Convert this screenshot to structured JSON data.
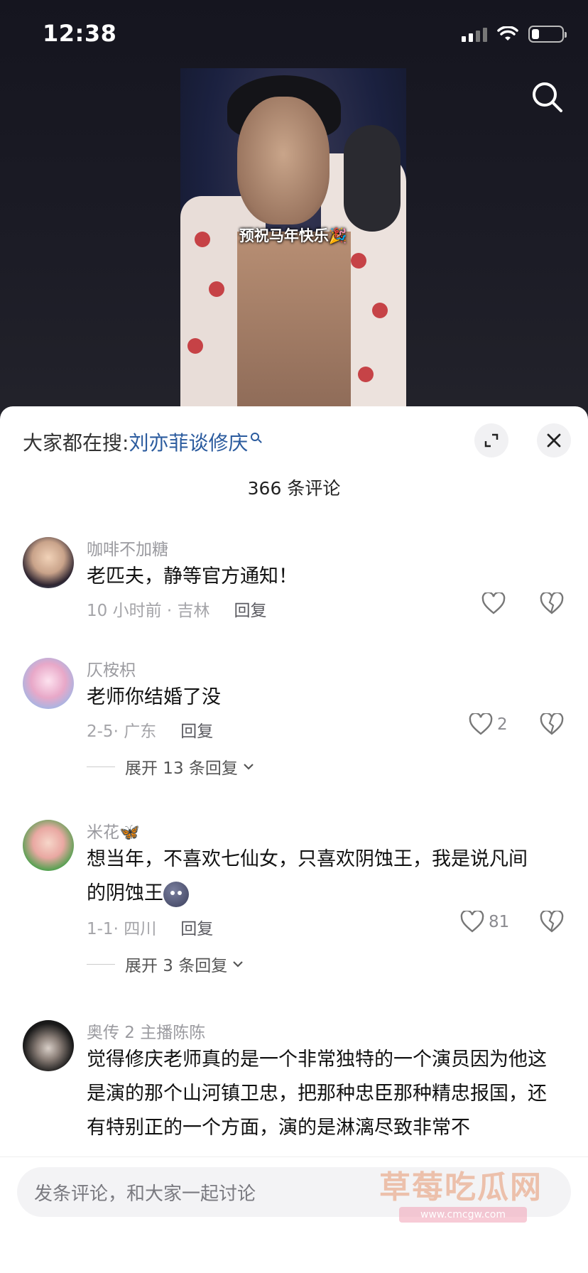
{
  "status_bar": {
    "time": "12:38"
  },
  "video": {
    "caption": "预祝马年快乐🎉"
  },
  "sheet": {
    "hot_search_prefix": "大家都在搜: ",
    "hot_search_keyword": "刘亦菲谈修庆",
    "comment_count": "366 条评论"
  },
  "comments": [
    {
      "username": "咖啡不加糖",
      "text": "老匹夫，静等官方通知！",
      "time_location": "10 小时前 · 吉林",
      "reply_label": "回复",
      "likes": ""
    },
    {
      "username": "仄桉枳",
      "text": "老师你结婚了没",
      "time_location": "2-5· 广东",
      "reply_label": "回复",
      "likes": "2",
      "expand_label": "展开 13 条回复"
    },
    {
      "username": "米花🦋",
      "text_line1": "想当年，不喜欢七仙女，只喜欢阴蚀王，我是说凡间",
      "text_line2": "的阴蚀王",
      "time_location": "1-1· 四川",
      "reply_label": "回复",
      "likes": "81",
      "expand_label": "展开 3 条回复"
    },
    {
      "username": "奥传 2 主播陈陈",
      "text": "觉得修庆老师真的是一个非常独特的一个演员因为他这是演的那个山河镇卫忠，把那种忠臣那种精忠报国，还有特别正的一个方面，演的是淋漓尽致非常不"
    }
  ],
  "input": {
    "placeholder": "发条评论，和大家一起讨论"
  },
  "watermark": {
    "text": "草莓吃瓜网",
    "url": "www.cmcgw.com"
  }
}
